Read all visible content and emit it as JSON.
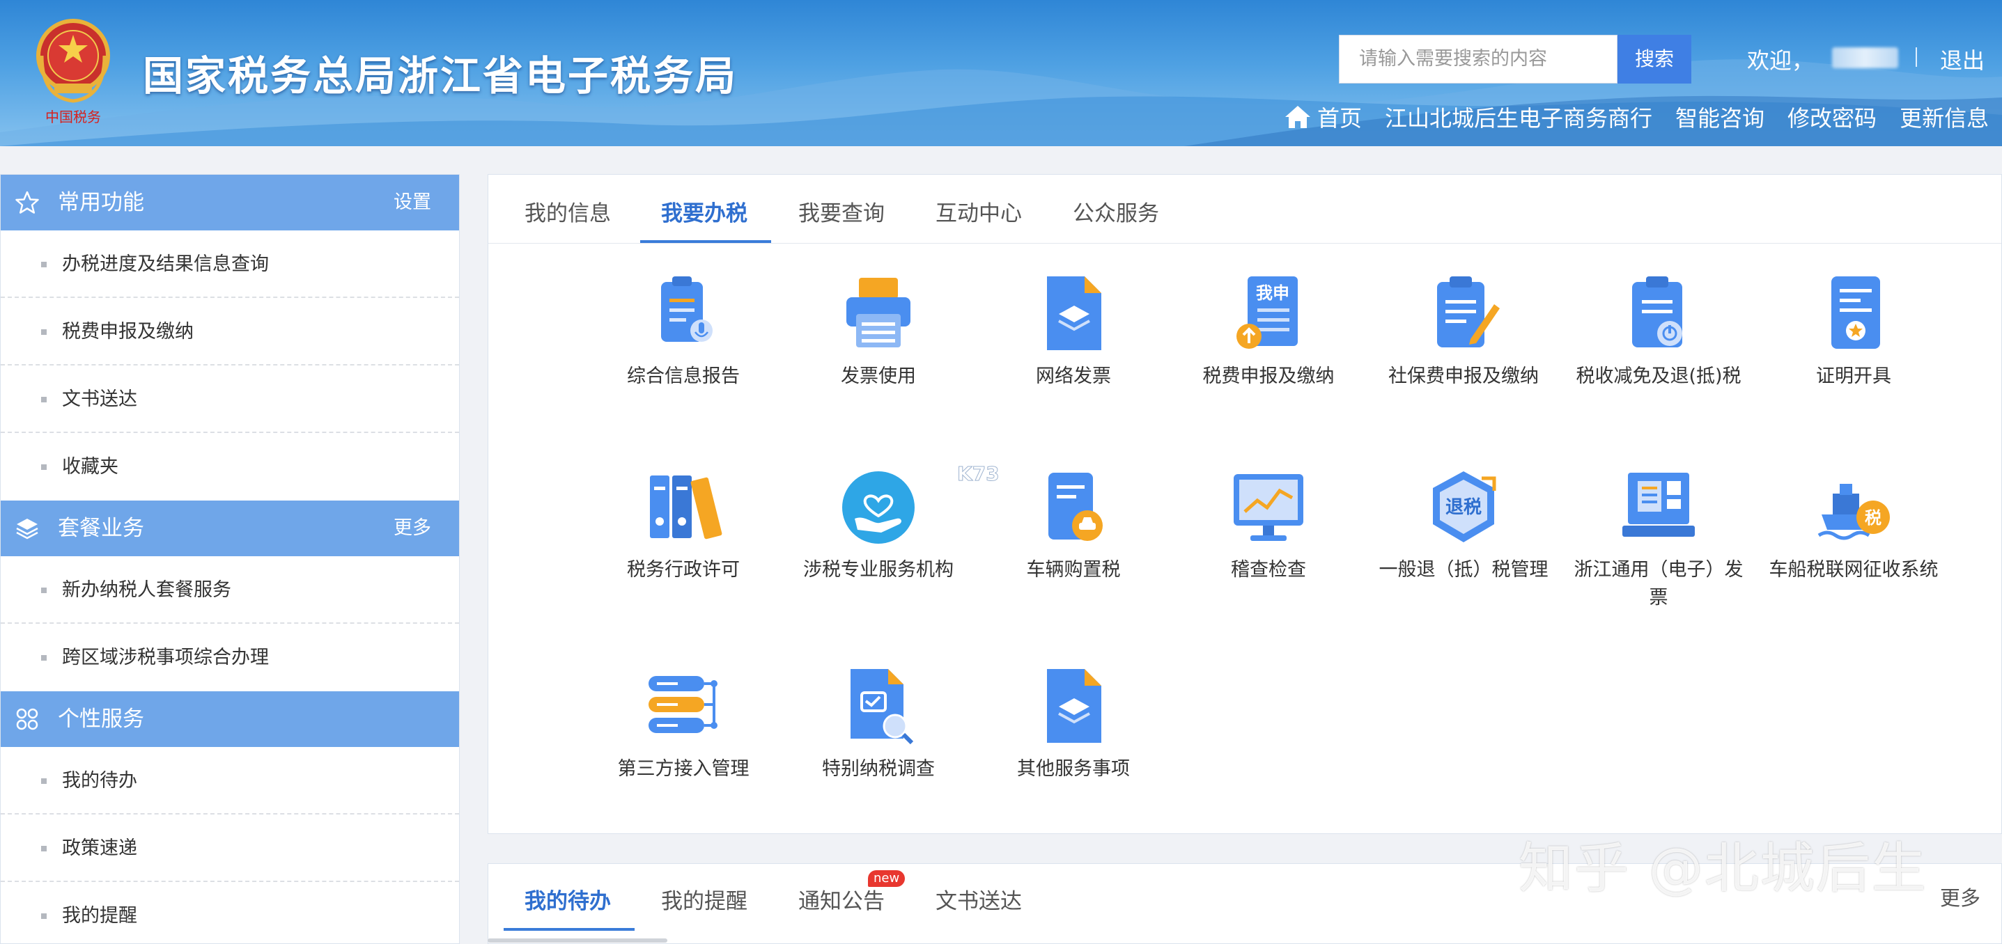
{
  "header": {
    "site_title": "国家税务总局浙江省电子税务局",
    "seal_text": "中国税务",
    "search_placeholder": "请输入需要搜索的内容",
    "search_button": "搜索",
    "welcome": "欢迎，",
    "logout": "退出",
    "nav": [
      "首页",
      "江山北城后生电子商务商行",
      "智能咨询",
      "修改密码",
      "更新信息"
    ]
  },
  "sidebar": {
    "sections": [
      {
        "title": "常用功能",
        "link": "设置",
        "icon": "star-icon",
        "items": [
          "办税进度及结果信息查询",
          "税费申报及缴纳",
          "文书送达",
          "收藏夹"
        ]
      },
      {
        "title": "套餐业务",
        "link": "更多",
        "icon": "layers-icon",
        "items": [
          "新办纳税人套餐服务",
          "跨区域涉税事项综合办理"
        ]
      },
      {
        "title": "个性服务",
        "link": "",
        "icon": "grid-icon",
        "items": [
          "我的待办",
          "政策速递",
          "我的提醒"
        ]
      }
    ]
  },
  "main": {
    "tabs": [
      "我的信息",
      "我要办税",
      "我要查询",
      "互动中心",
      "公众服务"
    ],
    "active_tab": "我要办税",
    "services": [
      {
        "label": "综合信息报告",
        "icon": "clipboard-mic-icon"
      },
      {
        "label": "发票使用",
        "icon": "printer-icon"
      },
      {
        "label": "网络发票",
        "icon": "layers-doc-icon"
      },
      {
        "label": "税费申报及缴纳",
        "icon": "declare-doc-icon",
        "icon_text": "我申"
      },
      {
        "label": "社保费申报及缴纳",
        "icon": "clipboard-pen-icon"
      },
      {
        "label": "税收减免及退(抵)税",
        "icon": "clipboard-power-icon"
      },
      {
        "label": "证明开具",
        "icon": "certificate-icon"
      },
      {
        "label": "税务行政许可",
        "icon": "binders-icon"
      },
      {
        "label": "涉税专业服务机构",
        "icon": "hand-heart-icon"
      },
      {
        "label": "车辆购置税",
        "icon": "car-doc-icon"
      },
      {
        "label": "稽查检查",
        "icon": "monitor-chart-icon"
      },
      {
        "label": "一般退（抵）税管理",
        "icon": "refund-hexagon-icon",
        "icon_text": "退税"
      },
      {
        "label": "浙江通用（电子）发票",
        "icon": "receipt-register-icon"
      },
      {
        "label": "车船税联网征收系统",
        "icon": "ship-tax-icon",
        "icon_text": "税"
      },
      {
        "label": "第三方接入管理",
        "icon": "server-connect-icon"
      },
      {
        "label": "特别纳税调查",
        "icon": "doc-search-icon"
      },
      {
        "label": "其他服务事项",
        "icon": "layers-doc-icon"
      }
    ]
  },
  "bottom_panel": {
    "tabs": [
      "我的待办",
      "我的提醒",
      "通知公告",
      "文书送达"
    ],
    "active_tab": "我的待办",
    "badge": "new",
    "more": "更多"
  },
  "overlays": {
    "watermark": "知乎 @北城后生",
    "k73_watermark": "K73"
  },
  "colors": {
    "header_blue": "#2f86d6",
    "section_blue": "#6fa6e9",
    "tab_active": "#2f6fcf",
    "search_button": "#3f7fe4",
    "badge_red": "#e8372f",
    "icon_blue": "#4a8ef0",
    "icon_orange": "#f5a623"
  }
}
